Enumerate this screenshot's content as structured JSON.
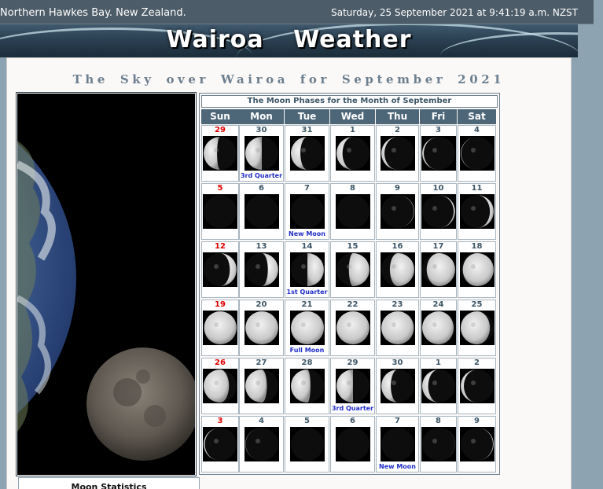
{
  "header": {
    "location": "Northern Hawkes Bay. New Zealand.",
    "datetime": "Saturday, 25 September 2021 at 9:41:19 a.m. NZST"
  },
  "banner": {
    "title": "Wairoa Weather"
  },
  "page": {
    "heading": "The Sky over Wairoa for September 2021",
    "stats_title": "Moon Statistics"
  },
  "moon_table": {
    "title": "The Moon Phases for the Month of September",
    "days": [
      "Sun",
      "Mon",
      "Tue",
      "Wed",
      "Thu",
      "Fri",
      "Sat"
    ],
    "weeks": [
      [
        {
          "d": "29",
          "ph": 0.78
        },
        {
          "d": "30",
          "ph": 0.75,
          "label": "3rd Quarter"
        },
        {
          "d": "31",
          "ph": 0.82
        },
        {
          "d": "1",
          "ph": 0.86
        },
        {
          "d": "2",
          "ph": 0.9
        },
        {
          "d": "3",
          "ph": 0.93
        },
        {
          "d": "4",
          "ph": 0.96
        }
      ],
      [
        {
          "d": "5",
          "ph": 0.99
        },
        {
          "d": "6",
          "ph": 0.0
        },
        {
          "d": "7",
          "ph": 0.0,
          "label": "New Moon"
        },
        {
          "d": "8",
          "ph": 0.01
        },
        {
          "d": "9",
          "ph": 0.04
        },
        {
          "d": "10",
          "ph": 0.07
        },
        {
          "d": "11",
          "ph": 0.11
        }
      ],
      [
        {
          "d": "12",
          "ph": 0.15
        },
        {
          "d": "13",
          "ph": 0.19
        },
        {
          "d": "14",
          "ph": 0.25,
          "label": "1st Quarter"
        },
        {
          "d": "15",
          "ph": 0.29
        },
        {
          "d": "16",
          "ph": 0.33
        },
        {
          "d": "17",
          "ph": 0.38
        },
        {
          "d": "18",
          "ph": 0.42
        }
      ],
      [
        {
          "d": "19",
          "ph": 0.46
        },
        {
          "d": "20",
          "ph": 0.48
        },
        {
          "d": "21",
          "ph": 0.5,
          "label": "Full Moon"
        },
        {
          "d": "22",
          "ph": 0.52
        },
        {
          "d": "23",
          "ph": 0.54
        },
        {
          "d": "24",
          "ph": 0.57
        },
        {
          "d": "25",
          "ph": 0.61
        }
      ],
      [
        {
          "d": "26",
          "ph": 0.66
        },
        {
          "d": "27",
          "ph": 0.7
        },
        {
          "d": "28",
          "ph": 0.72
        },
        {
          "d": "29",
          "ph": 0.75,
          "label": "3rd Quarter"
        },
        {
          "d": "30",
          "ph": 0.82
        },
        {
          "d": "1",
          "ph": 0.86
        },
        {
          "d": "2",
          "ph": 0.9
        }
      ],
      [
        {
          "d": "3",
          "ph": 0.94
        },
        {
          "d": "4",
          "ph": 0.97
        },
        {
          "d": "5",
          "ph": 0.0
        },
        {
          "d": "6",
          "ph": 0.0
        },
        {
          "d": "7",
          "ph": 0.0,
          "label": "New Moon"
        },
        {
          "d": "8",
          "ph": 0.02
        },
        {
          "d": "9",
          "ph": 0.05
        }
      ]
    ]
  },
  "colors": {
    "top_bar": "#4c5c68",
    "banner": "#2b4153",
    "day_header": "#4d6678",
    "sunday_number": "#e00000",
    "phase_label": "#1f2cc8"
  }
}
